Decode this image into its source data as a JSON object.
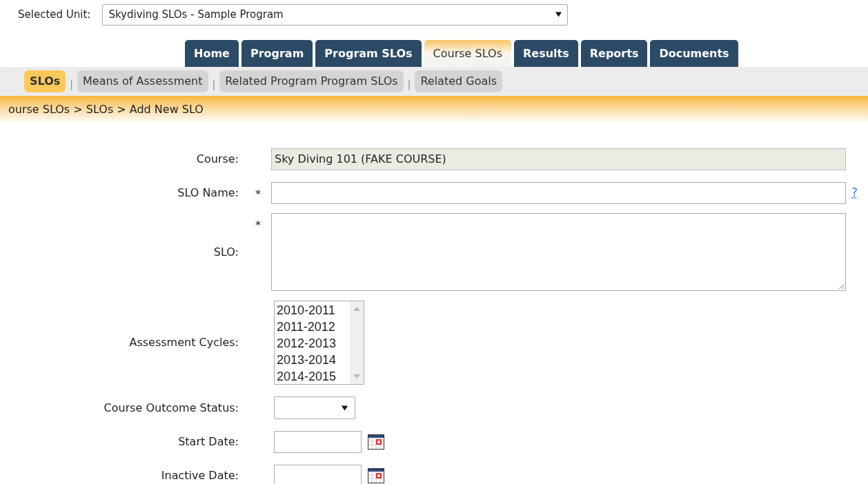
{
  "selected_unit": {
    "label": "Selected Unit:",
    "value": "Skydiving SLOs - Sample Program"
  },
  "tabs": [
    {
      "label": "Home",
      "selected": false
    },
    {
      "label": "Program",
      "selected": false
    },
    {
      "label": "Program SLOs",
      "selected": false
    },
    {
      "label": "Course SLOs",
      "selected": true
    },
    {
      "label": "Results",
      "selected": false
    },
    {
      "label": "Reports",
      "selected": false
    },
    {
      "label": "Documents",
      "selected": false
    }
  ],
  "subtabs": [
    {
      "label": "SLOs",
      "selected": true
    },
    {
      "separator": "|",
      "label": "Means of Assessment",
      "selected": false
    },
    {
      "separator": "|",
      "label": "Related Program Program SLOs",
      "selected": false
    },
    {
      "separator": "|",
      "label": "Related Goals",
      "selected": false
    }
  ],
  "breadcrumb": "ourse SLOs > SLOs > Add New SLO",
  "form": {
    "fields": [
      {
        "kind": "readonly",
        "label": "Course:",
        "value": "Sky Diving 101 (FAKE COURSE)"
      },
      {
        "kind": "text",
        "label": "SLO Name:",
        "required_mark": "*",
        "help": "?"
      },
      {
        "kind": "textarea",
        "label": "SLO:",
        "required_mark": "*"
      },
      {
        "kind": "listbox",
        "label": "Assessment Cycles:",
        "options": [
          "2010-2011",
          "2011-2012",
          "2012-2013",
          "2013-2014",
          "2014-2015"
        ]
      },
      {
        "kind": "select",
        "label": "Course Outcome Status:"
      },
      {
        "kind": "date",
        "label": "Start Date:"
      },
      {
        "kind": "date",
        "label": "Inactive Date:"
      }
    ]
  }
}
